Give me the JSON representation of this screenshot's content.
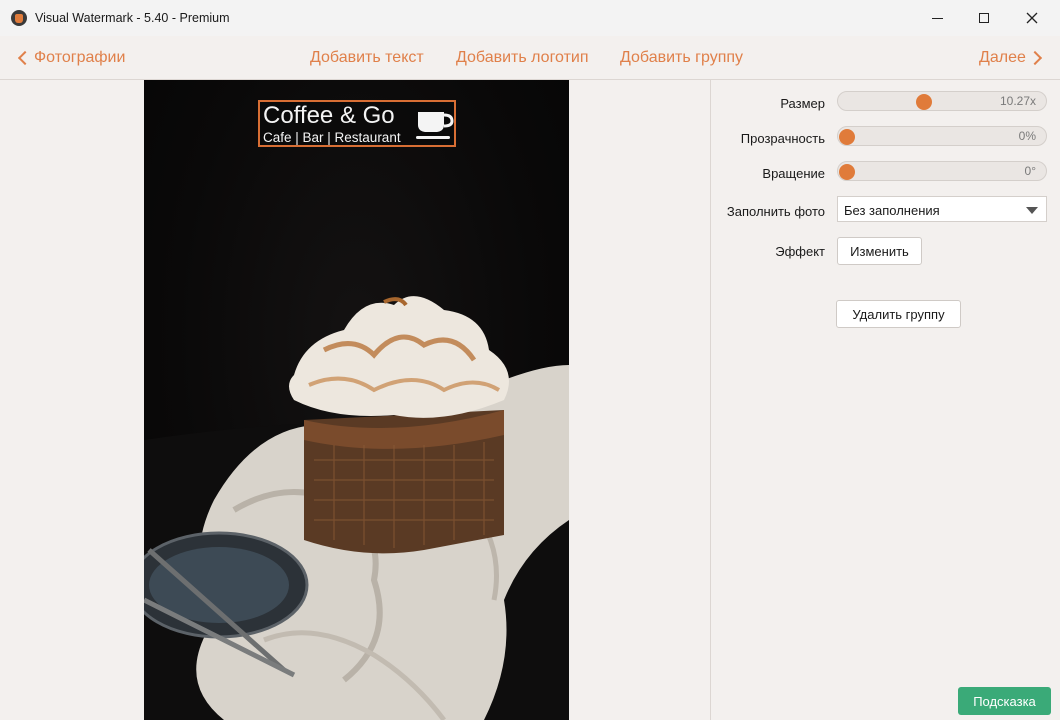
{
  "window": {
    "title": "Visual Watermark - 5.40 - Premium"
  },
  "nav": {
    "back_label": "Фотографии",
    "add_text_label": "Добавить текст",
    "add_logo_label": "Добавить логотип",
    "add_group_label": "Добавить группу",
    "next_label": "Далее"
  },
  "watermark": {
    "title": "Coffee & Go",
    "subtitle": "Cafe | Bar | Restaurant"
  },
  "panel": {
    "size": {
      "label": "Размер",
      "value": "10.27x",
      "level": 0.4
    },
    "opacity": {
      "label": "Прозрачность",
      "value": "0%",
      "level": 0.0
    },
    "rotation": {
      "label": "Вращение",
      "value": "0°",
      "level": 0.0
    },
    "fill": {
      "label": "Заполнить фото",
      "selected": "Без заполнения"
    },
    "effect": {
      "label": "Эффект",
      "button_label": "Изменить"
    },
    "delete_group_label": "Удалить группу"
  },
  "hint_label": "Подсказка",
  "colors": {
    "accent": "#e07b3a",
    "hint_button": "#3aaa78",
    "watermark_border": "#d86e34"
  }
}
